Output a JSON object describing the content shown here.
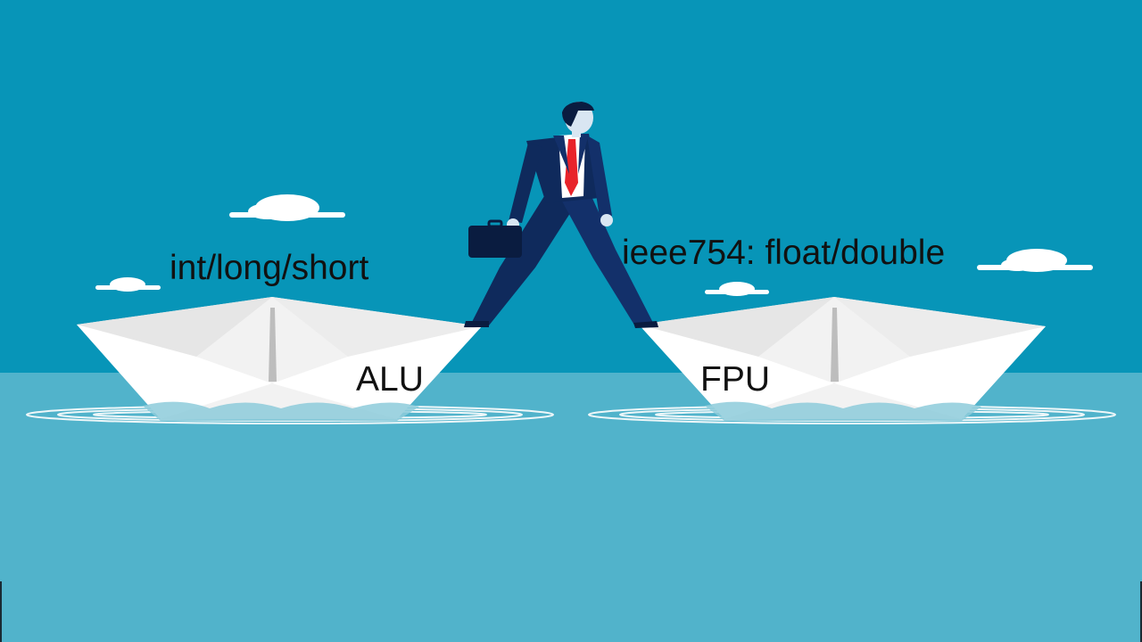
{
  "colors": {
    "sky": "#0795b8",
    "sea": "#51b3cb",
    "suit": "#0f2a5c",
    "tie": "#e8232a",
    "boat": "#ffffff"
  },
  "labels": {
    "alu_types": "int/long/short",
    "fpu_types": "ieee754: float/double",
    "alu": "ALU",
    "fpu": "FPU"
  }
}
